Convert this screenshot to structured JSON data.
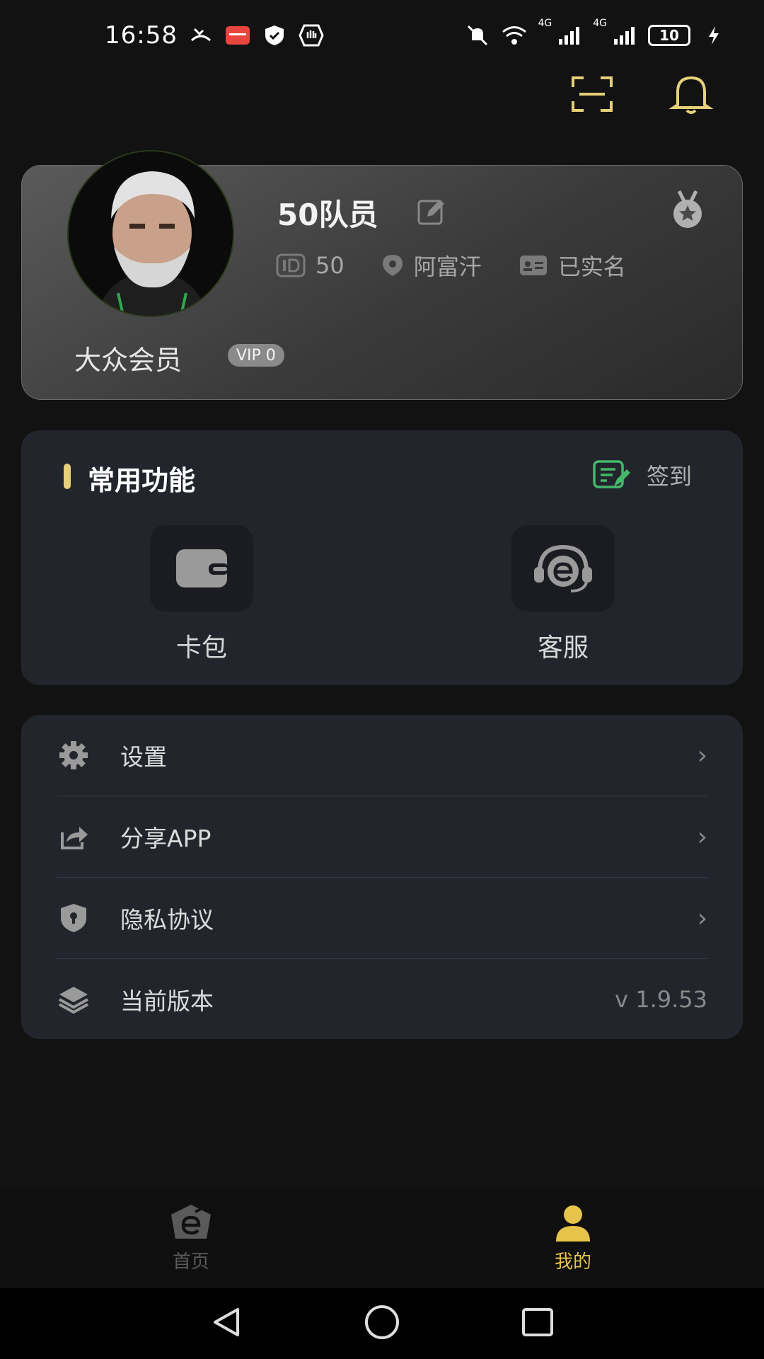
{
  "status_bar": {
    "time": "16:58",
    "net_1": "4G",
    "net_2": "4G",
    "battery": "10"
  },
  "profile": {
    "username": "50队员",
    "id_value": "50",
    "location": "阿富汗",
    "verified": "已实名",
    "member_title": "大众会员",
    "vip_badge": "VIP 0"
  },
  "functions": {
    "title": "常用功能",
    "signin_label": "签到",
    "items": [
      {
        "label": "卡包",
        "icon": "wallet-icon"
      },
      {
        "label": "客服",
        "icon": "headset-icon"
      }
    ]
  },
  "menu": {
    "items": [
      {
        "label": "设置",
        "icon": "gear-icon"
      },
      {
        "label": "分享APP",
        "icon": "share-icon"
      },
      {
        "label": "隐私协议",
        "icon": "shield-icon"
      },
      {
        "label": "当前版本",
        "icon": "layers-icon",
        "value": "v 1.9.53"
      }
    ]
  },
  "bottom_nav": {
    "items": [
      {
        "label": "首页",
        "icon": "home-e-icon",
        "active": false
      },
      {
        "label": "我的",
        "icon": "user-icon",
        "active": true
      }
    ]
  },
  "colors": {
    "accent": "#e6cf7a",
    "card_bg": "#22252c",
    "page_bg": "#121212",
    "active_tab": "#e6c34a"
  }
}
